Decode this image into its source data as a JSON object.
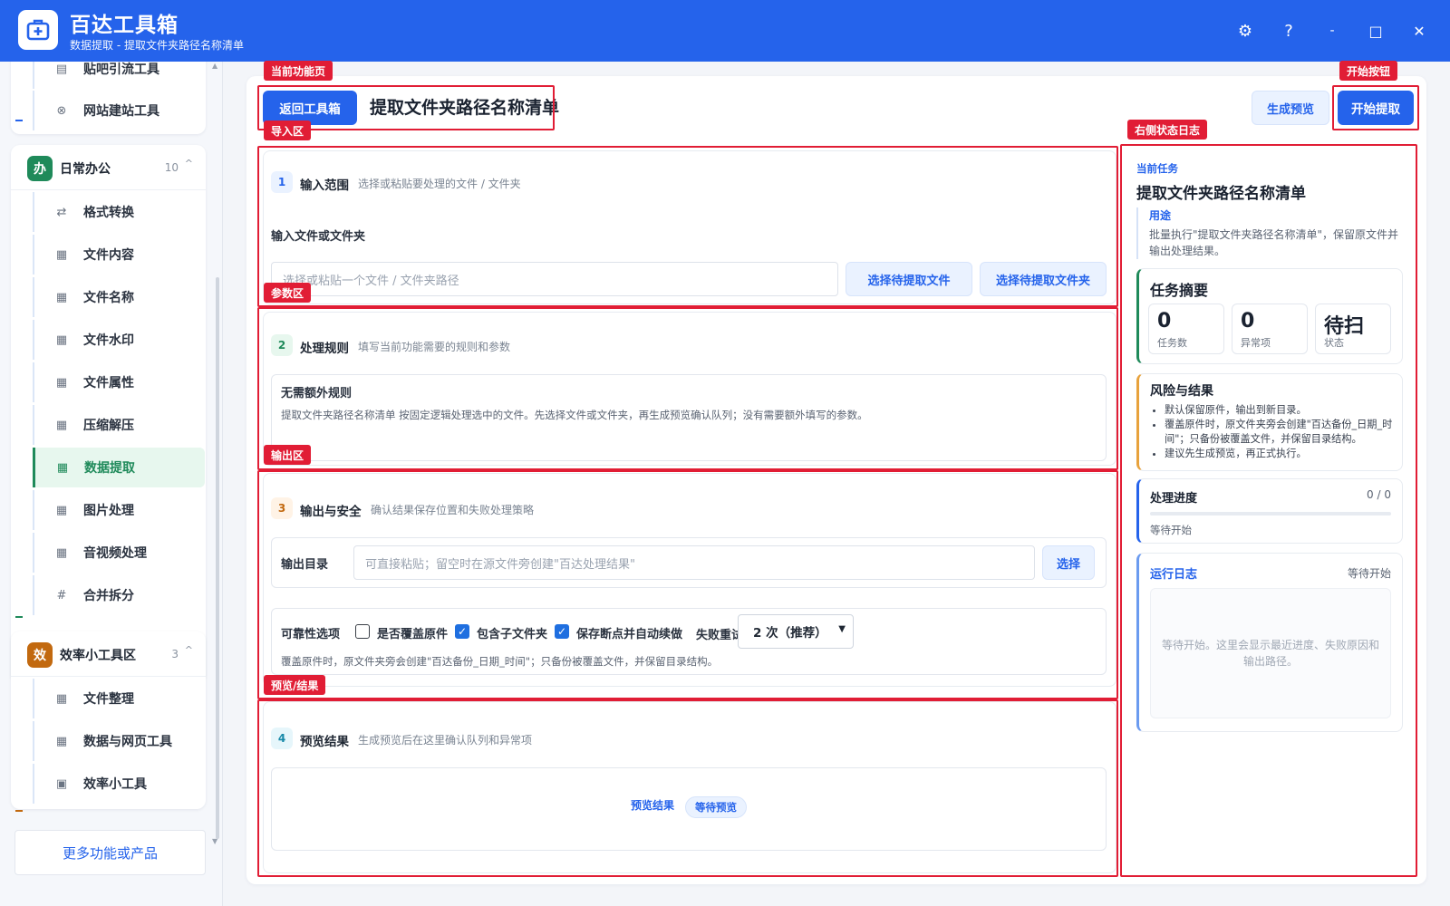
{
  "app": {
    "title": "百达工具箱",
    "subtitle": "数据提取 - 提取文件夹路径名称清单",
    "window_controls": {
      "settings": "⚙",
      "help": "?",
      "minimize": "-",
      "maximize": "□",
      "close": "✕"
    }
  },
  "sidebar": {
    "top_items": [
      {
        "icon": "doc-icon",
        "label": "贴吧引流工具"
      },
      {
        "icon": "globe-icon",
        "label": "网站建站工具"
      }
    ],
    "groups": [
      {
        "badge": "办",
        "badge_color": "#1f8a5a",
        "name": "日常办公",
        "count": "10",
        "caret": "^",
        "items": [
          {
            "icon": "swap-icon",
            "label": "格式转换"
          },
          {
            "icon": "grid-icon",
            "label": "文件内容"
          },
          {
            "icon": "grid-icon",
            "label": "文件名称"
          },
          {
            "icon": "grid-icon",
            "label": "文件水印"
          },
          {
            "icon": "grid-icon",
            "label": "文件属性"
          },
          {
            "icon": "grid-icon",
            "label": "压缩解压"
          },
          {
            "icon": "grid-icon",
            "label": "数据提取",
            "active": true
          },
          {
            "icon": "grid-icon",
            "label": "图片处理"
          },
          {
            "icon": "grid-icon",
            "label": "音视频处理"
          },
          {
            "icon": "hash-icon",
            "label": "合并拆分"
          }
        ]
      },
      {
        "badge": "效",
        "badge_color": "#c2690f",
        "name": "效率小工具区",
        "count": "3",
        "caret": "^",
        "items": [
          {
            "icon": "grid-icon",
            "label": "文件整理"
          },
          {
            "icon": "grid-icon",
            "label": "数据与网页工具"
          },
          {
            "icon": "box-icon",
            "label": "效率小工具"
          }
        ]
      }
    ],
    "more_label": "更多功能或产品"
  },
  "header": {
    "back_label": "返回工具箱",
    "page_title": "提取文件夹路径名称清单",
    "preview_label": "生成预览",
    "start_label": "开始提取"
  },
  "sections": {
    "input": {
      "step": "1",
      "title": "输入范围",
      "desc": "选择或粘贴要处理的文件 / 文件夹",
      "field_label": "输入文件或文件夹",
      "placeholder": "选择或粘贴一个文件 / 文件夹路径",
      "pick_file": "选择待提取文件",
      "pick_folder": "选择待提取文件夹"
    },
    "rules": {
      "step": "2",
      "title": "处理规则",
      "desc": "填写当前功能需要的规则和参数",
      "box_title": "无需额外规则",
      "box_text": "提取文件夹路径名称清单 按固定逻辑处理选中的文件。先选择文件或文件夹，再生成预览确认队列；没有需要额外填写的参数。"
    },
    "output": {
      "step": "3",
      "title": "输出与安全",
      "desc": "确认结果保存位置和失败处理策略",
      "dir_label": "输出目录",
      "dir_placeholder": "可直接粘贴；留空时在源文件旁创建\"百达处理结果\"",
      "choose_label": "选择",
      "reliability_label": "可靠性选项",
      "opt_overwrite": "是否覆盖原件",
      "opt_overwrite_checked": false,
      "opt_subfolders": "包含子文件夹",
      "opt_subfolders_checked": true,
      "opt_resume": "保存断点并自动续做",
      "opt_resume_checked": true,
      "retry_label": "失败重试",
      "retry_value": "2 次（推荐）",
      "note": "覆盖原件时，原文件夹旁会创建\"百达备份_日期_时间\"；只备份被覆盖文件，并保留目录结构。"
    },
    "preview": {
      "step": "4",
      "title": "预览结果",
      "desc": "生成预览后在这里确认队列和异常项",
      "result_label": "预览结果",
      "status_chip": "等待预览"
    }
  },
  "right_panel": {
    "kicker": "当前任务",
    "title": "提取文件夹路径名称清单",
    "usage_label": "用途",
    "usage_text": "批量执行\"提取文件夹路径名称清单\"，保留原文件并输出处理结果。",
    "summary_title": "任务摘要",
    "stats": [
      {
        "value": "0",
        "label": "任务数"
      },
      {
        "value": "0",
        "label": "异常项"
      },
      {
        "value": "待扫",
        "label": "状态"
      }
    ],
    "risk_title": "风险与结果",
    "risk_items": [
      "默认保留原件，输出到新目录。",
      "覆盖原件时，原文件夹旁会创建\"百达备份_日期_时间\"；只备份被覆盖文件，并保留目录结构。",
      "建议先生成预览，再正式执行。"
    ],
    "progress_title": "处理进度",
    "progress_count": "0 / 0",
    "progress_value": 0,
    "progress_status": "等待开始",
    "log_title": "运行日志",
    "log_status": "等待开始",
    "log_placeholder": "等待开始。这里会显示最近进度、失败原因和输出路径。"
  },
  "annotations": {
    "current_page": "当前功能页",
    "start_button": "开始按钮",
    "import_zone": "导入区",
    "right_log": "右侧状态日志",
    "params_zone": "参数区",
    "output_zone": "输出区",
    "preview_zone": "预览/结果"
  },
  "colors": {
    "accent": "#2563eb",
    "annotation": "#e11d35",
    "active_green": "#1f8a5a",
    "orange": "#c2690f"
  }
}
